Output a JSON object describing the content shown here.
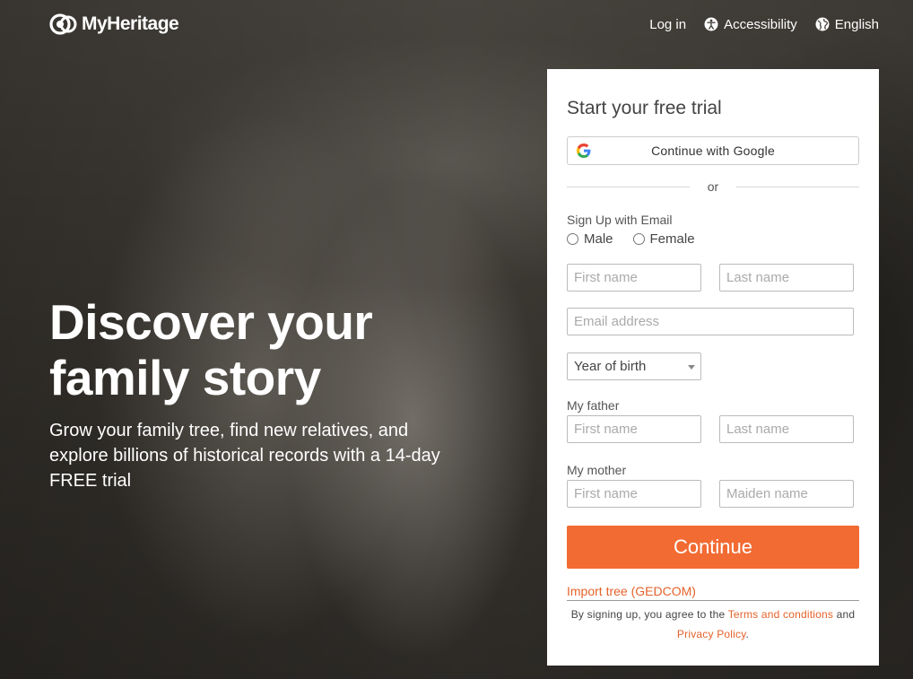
{
  "header": {
    "logo_text": "MyHeritage",
    "nav": {
      "login": "Log in",
      "accessibility": "Accessibility",
      "language": "English"
    }
  },
  "hero": {
    "headline_line1": "Discover your",
    "headline_line2": "family story",
    "subhead": "Grow your family tree, find new relatives, and explore billions of historical records with a 14-day FREE trial"
  },
  "form": {
    "title": "Start your free trial",
    "google_button": "Continue with Google",
    "divider": "or",
    "signup_label": "Sign Up with Email",
    "gender": {
      "male": "Male",
      "female": "Female"
    },
    "first_name_placeholder": "First name",
    "last_name_placeholder": "Last name",
    "email_placeholder": "Email address",
    "year_of_birth": "Year of birth",
    "father_label": "My father",
    "father_first_placeholder": "First name",
    "father_last_placeholder": "Last name",
    "mother_label": "My mother",
    "mother_first_placeholder": "First name",
    "mother_maiden_placeholder": "Maiden name",
    "continue_button": "Continue",
    "import_link": "Import tree (GEDCOM)",
    "terms_prefix": "By signing up, you agree to the",
    "terms_link": "Terms and conditions",
    "terms_and": "and",
    "privacy_link": "Privacy Policy",
    "terms_suffix": "."
  },
  "colors": {
    "accent": "#f26b33",
    "link": "#e5622a",
    "card_bg": "#ffffff"
  },
  "icons": [
    "myheritage-logo-icon",
    "accessibility-icon",
    "globe-icon",
    "google-icon",
    "dropdown-caret-icon"
  ]
}
